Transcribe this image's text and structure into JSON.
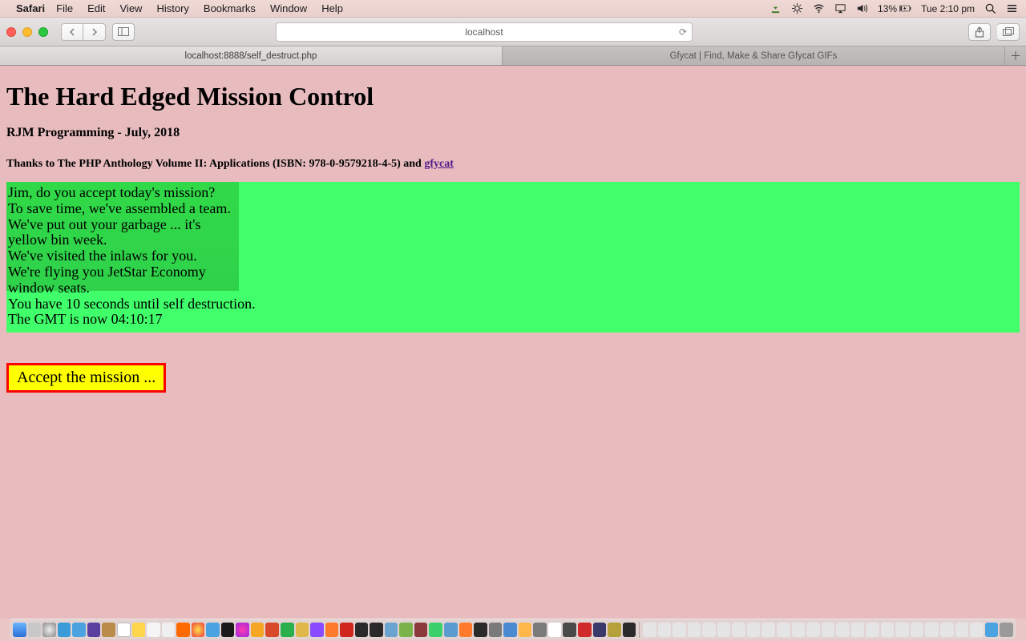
{
  "menubar": {
    "app": "Safari",
    "items": [
      "File",
      "Edit",
      "View",
      "History",
      "Bookmarks",
      "Window",
      "Help"
    ],
    "battery_pct": "13%",
    "clock": "Tue 2:10 pm"
  },
  "toolbar": {
    "address": "localhost"
  },
  "tabs": {
    "active": "localhost:8888/self_destruct.php",
    "inactive": "Gfycat | Find, Make & Share Gfycat GIFs"
  },
  "page": {
    "title": "The Hard Edged Mission Control",
    "subtitle": "RJM Programming - July, 2018",
    "thanks_prefix": "Thanks to The PHP Anthology Volume II: Applications (ISBN: 978-0-9579218-4-5) and ",
    "thanks_link_text": "gfycat",
    "mission_lines": [
      "Jim, do you accept today's mission?",
      "To save time, we've assembled a team.",
      "We've put out your garbage ... it's",
      "yellow bin week.",
      "We've visited the inlaws for you.",
      "We're flying you JetStar Economy",
      "window seats.",
      "You have 10 seconds until self destruction.",
      "The GMT is now 04:10:17"
    ],
    "accept_label": "Accept the mission ..."
  }
}
